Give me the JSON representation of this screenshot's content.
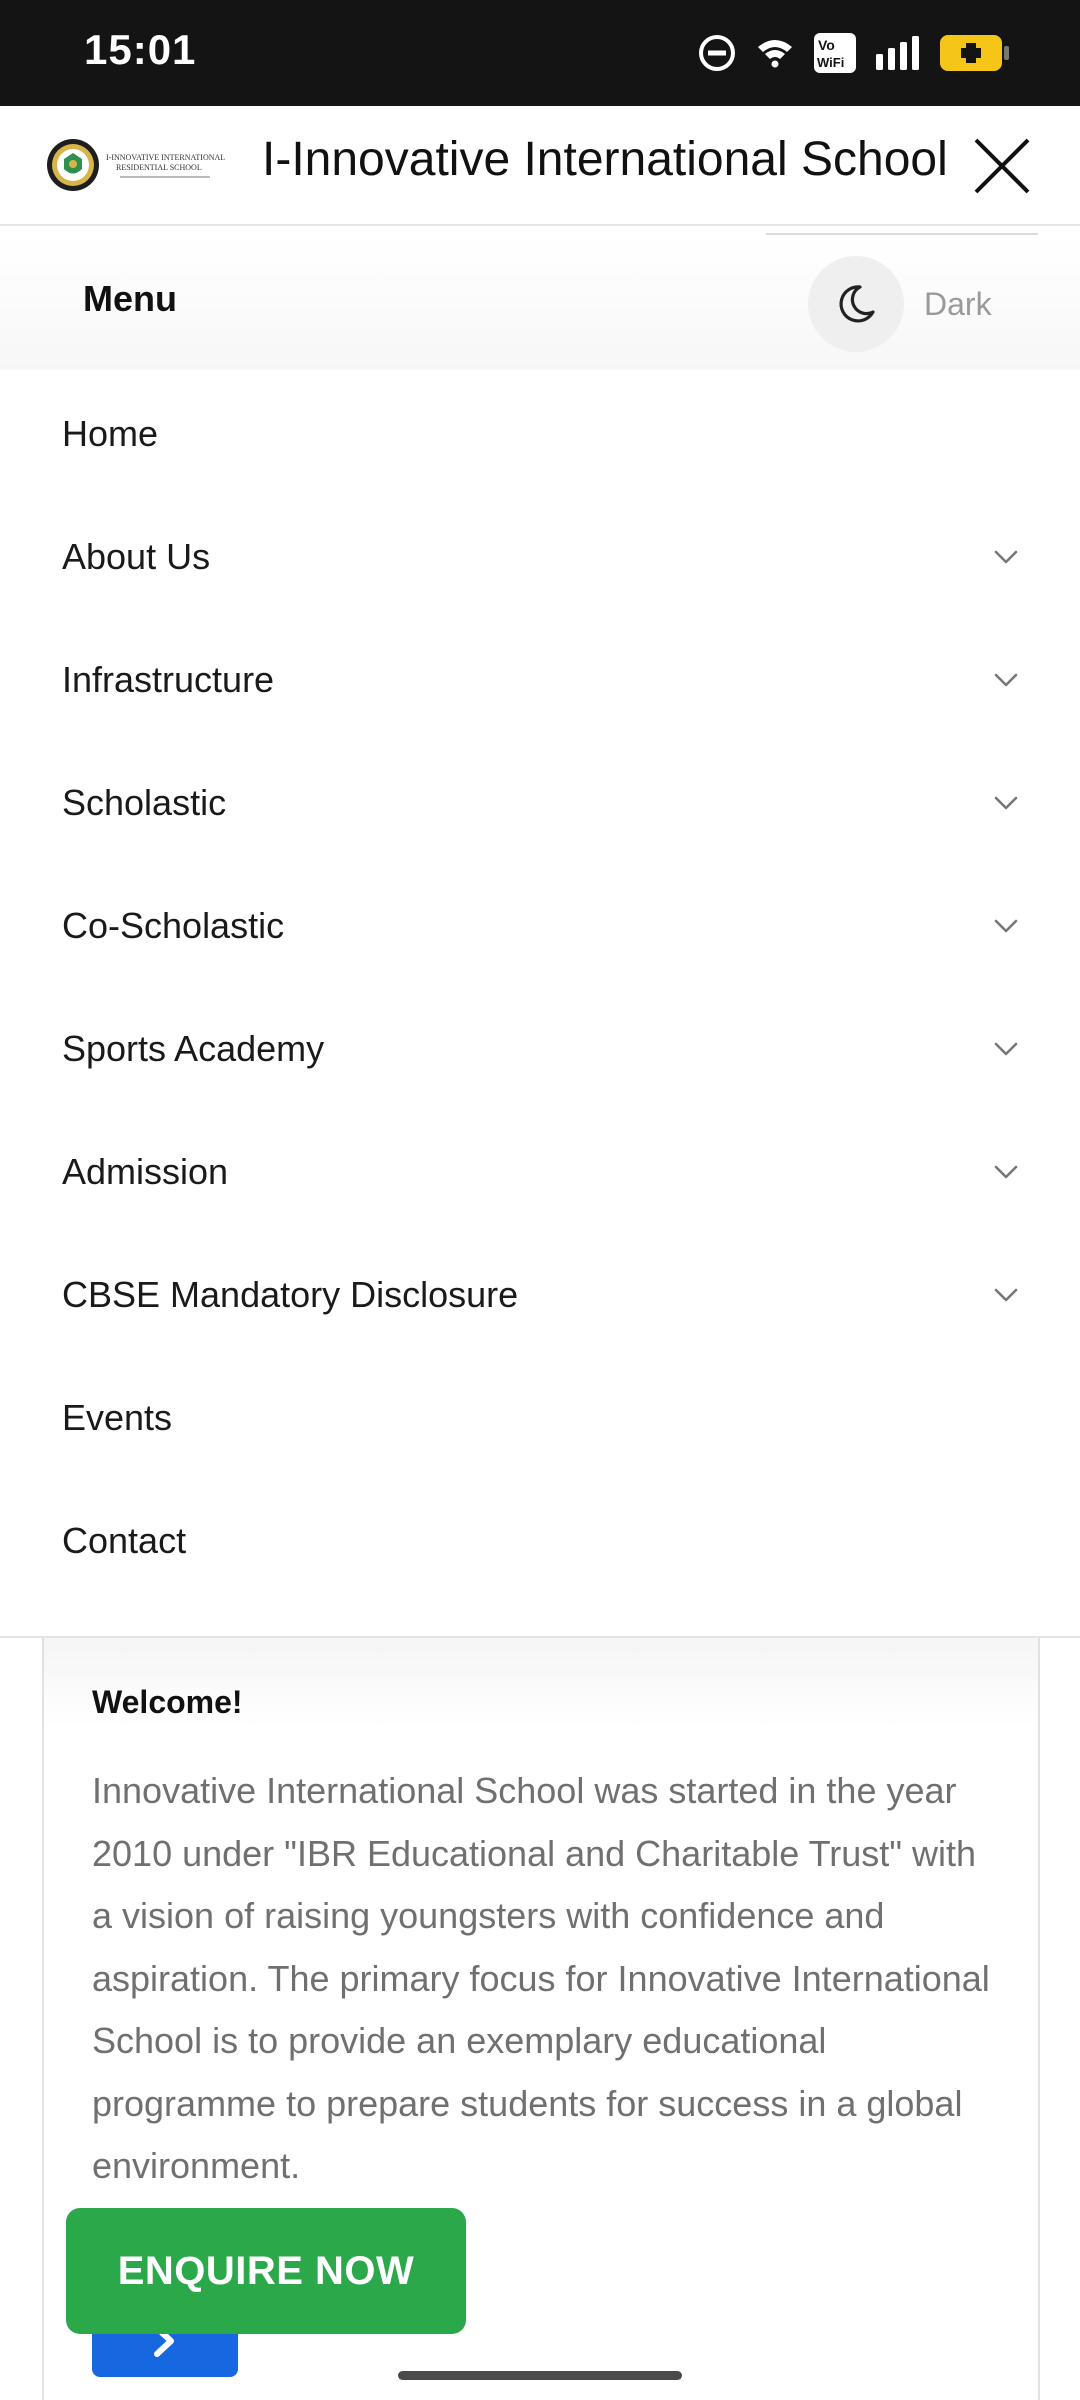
{
  "status_bar": {
    "time": "15:01",
    "icons": [
      "do-not-disturb-icon",
      "wifi-icon",
      "vowifi-icon",
      "signal-icon",
      "battery-charging-icon"
    ],
    "vowifi_top": "Vo",
    "vowifi_bottom": "WiFi"
  },
  "header": {
    "title": "I-Innovative International School",
    "logo_line1": "I-INNOVATIVE INTERNATIONAL",
    "logo_line2": "RESIDENTIAL SCHOOL"
  },
  "menu_header": {
    "label": "Menu",
    "dark_label": "Dark"
  },
  "menu": {
    "items": [
      {
        "label": "Home",
        "has_submenu": false
      },
      {
        "label": "About Us",
        "has_submenu": true
      },
      {
        "label": "Infrastructure",
        "has_submenu": true
      },
      {
        "label": "Scholastic",
        "has_submenu": true
      },
      {
        "label": "Co-Scholastic",
        "has_submenu": true
      },
      {
        "label": "Sports Academy",
        "has_submenu": true
      },
      {
        "label": "Admission",
        "has_submenu": true
      },
      {
        "label": "CBSE Mandatory Disclosure",
        "has_submenu": true
      },
      {
        "label": "Events",
        "has_submenu": false
      },
      {
        "label": "Contact",
        "has_submenu": false
      }
    ]
  },
  "welcome": {
    "title": "Welcome!",
    "text": "Innovative International School was started in the year 2010 under \"IBR Educational and Charitable Trust\" with a vision of raising youngsters with confidence and aspiration. The primary focus for Innovative International School is to provide an exemplary educational programme to prepare students for success in a global environment."
  },
  "enquire_button": {
    "label": "ENQUIRE NOW"
  },
  "colors": {
    "status_bar_bg": "#141414",
    "enquire_green": "#2aa84a",
    "arrow_blue": "#1768e0",
    "battery_yellow": "#f5c518"
  }
}
